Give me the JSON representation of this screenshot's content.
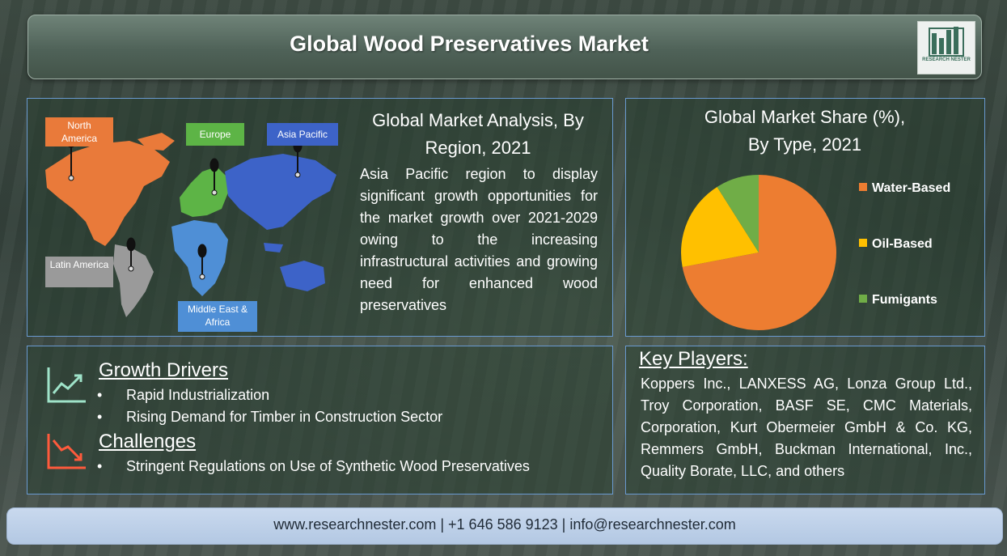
{
  "header": {
    "title": "Global Wood Preservatives Market",
    "logo_text": "RESEARCH NESTER"
  },
  "region_panel": {
    "title": "Global Market Analysis, By Region, 2021",
    "text": "Asia Pacific region to display significant growth opportunities for the market growth over 2021-2029 owing to the increasing infrastructural activities and growing need for enhanced wood preservatives",
    "regions": [
      {
        "label": "North America",
        "color": "#e97a3a"
      },
      {
        "label": "Europe",
        "color": "#5db446"
      },
      {
        "label": "Asia Pacific",
        "color": "#3d63c8"
      },
      {
        "label": "Latin America",
        "color": "#9a9a9a"
      },
      {
        "label": "Middle East & Africa",
        "color": "#4f8fd6"
      }
    ]
  },
  "share_panel": {
    "title_line1": "Global Market Share (%),",
    "title_line2": "By Type, 2021"
  },
  "chart_data": {
    "type": "pie",
    "title": "Global Market Share (%), By Type, 2021",
    "slices": [
      {
        "label": "Water-Based",
        "value": 72,
        "color": "#ed7d31"
      },
      {
        "label": "Oil-Based",
        "value": 19,
        "color": "#ffc000"
      },
      {
        "label": "Fumigants",
        "value": 9,
        "color": "#70ad47"
      }
    ],
    "legend_placement": "right"
  },
  "drivers": {
    "growth_title": "Growth Drivers",
    "growth_items": [
      "Rapid Industrialization",
      "Rising Demand for Timber in Construction Sector"
    ],
    "challenges_title": "Challenges",
    "challenge_items": [
      "Stringent Regulations on Use of Synthetic Wood Preservatives"
    ],
    "bullet": "•"
  },
  "players": {
    "title": "Key Players:",
    "text": "Koppers Inc., LANXESS AG, Lonza Group Ltd., Troy Corporation, BASF SE, CMC Materials, Corporation, Kurt Obermeier GmbH & Co. KG, Remmers GmbH, Buckman International, Inc., Quality Borate, LLC, and others"
  },
  "footer": {
    "text": "www.researchnester.com | +1 646 586 9123 | info@researchnester.com"
  }
}
